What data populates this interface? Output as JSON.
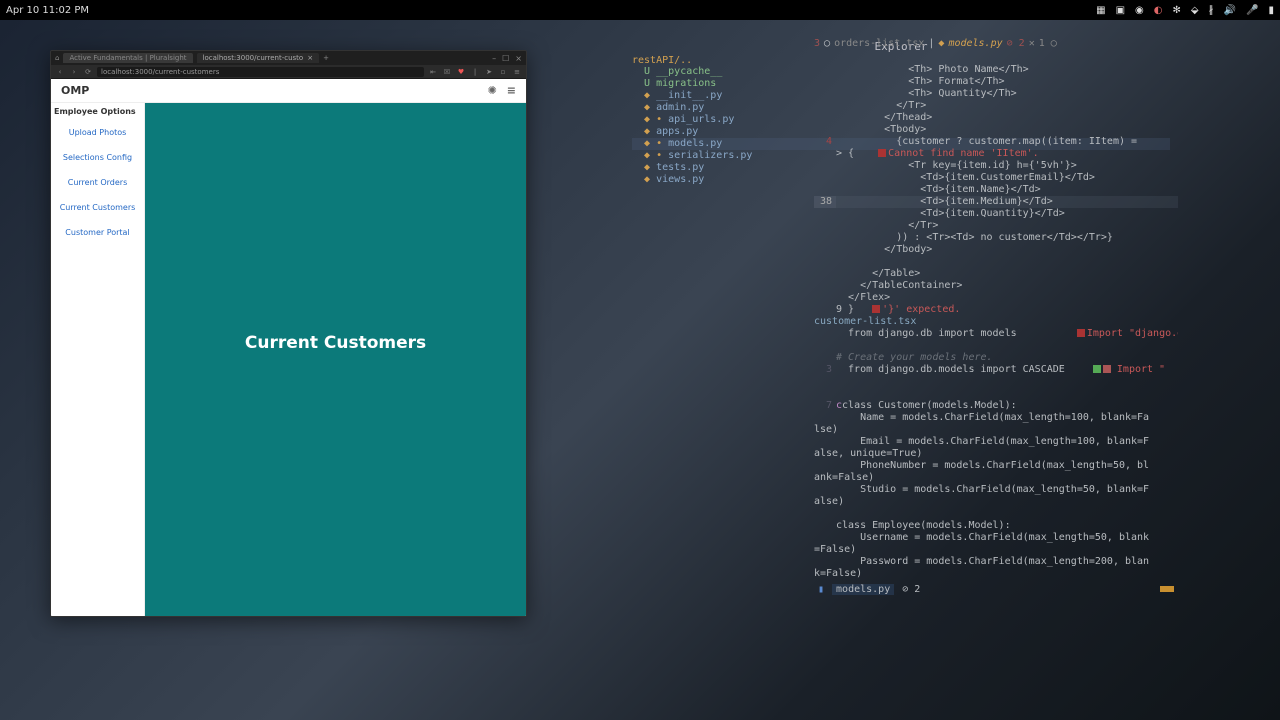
{
  "topbar": {
    "datetime": "Apr 10  11:02 PM"
  },
  "browser": {
    "tabs": [
      {
        "label": "Active Fundamentals | Pluralsight"
      },
      {
        "label": "localhost:3000/current-custo"
      }
    ],
    "url": "localhost:3000/current-customers",
    "app_title": "OMP",
    "sidebar_title": "Employee Options",
    "sidebar_items": [
      "Upload Photos",
      "Selections Config",
      "Current Orders",
      "Current Customers",
      "Customer Portal"
    ],
    "main_heading": "Current Customers"
  },
  "editor": {
    "explorer_title": "Explorer",
    "project_path": "restAPI/..",
    "tree": [
      {
        "marker": "U",
        "name": "__pycache__",
        "class": "u"
      },
      {
        "marker": "U",
        "name": "migrations",
        "class": "u"
      },
      {
        "marker": "◆",
        "name": "__init__.py",
        "class": "mod"
      },
      {
        "marker": "◆",
        "name": "admin.py",
        "class": "mod"
      },
      {
        "marker": "◆ •",
        "name": "api_urls.py",
        "class": "mod"
      },
      {
        "marker": "◆",
        "name": "apps.py",
        "class": "mod"
      },
      {
        "marker": "◆ •",
        "name": "models.py",
        "class": "mod",
        "active": true
      },
      {
        "marker": "◆ •",
        "name": "serializers.py",
        "class": "mod"
      },
      {
        "marker": "◆",
        "name": "tests.py",
        "class": "mod"
      },
      {
        "marker": "◆",
        "name": "views.py",
        "class": "mod"
      }
    ],
    "tabs": {
      "left_badge": "3",
      "tab1": "orders-list.tsx",
      "tab2": "models.py",
      "tab2_badge": "⊘ 2",
      "extra": "1 ◯"
    },
    "status": {
      "filename": "models.py",
      "count": "⊘ 2"
    },
    "code": {
      "l1": "            <Th> Photo Name</Th>",
      "l2": "            <Th> Format</Th>",
      "l3": "            <Th> Quantity</Th>",
      "l4": "          </Tr>",
      "l5": "        </Thead>",
      "l6": "        <Tbody>",
      "l7g": "4",
      "l7": "          {customer ? customer.map((item: IItem) =",
      "l8g": "> {",
      "l8e": "Cannot find name 'IItem'.",
      "l9": "            <Tr key={item.id} h={'5vh'}>",
      "l10": "              <Td>{item.CustomerEmail}</Td>",
      "l11": "              <Td>{item.Name}</Td>",
      "l12g": "38",
      "l12": "              <Td>{item.Medium}</Td>",
      "l13": "              <Td>{item.Quantity}</Td>",
      "l14": "            </Tr>",
      "l15": "          )) : <Tr><Td> no customer</Td></Tr>}",
      "l16": "        </Tbody>",
      "l17": "",
      "l18": "      </Table>",
      "l19": "    </TableContainer>",
      "l20": "  </Flex>",
      "l21g": "9 }",
      "l21e": "'}' expected.",
      "l22f": "customer-list.tsx",
      "l23": "  from django.db import models          ",
      "l23e": "Import \"django.db",
      "l24": "",
      "l25c": "# Create your models here.",
      "l26g": "3",
      "l26": "  from django.db.models import CASCADE    ",
      "l26e": "Import \"",
      "l27": "",
      "l28": "",
      "l29g": "7",
      "l29": "class Customer(models.Model):",
      "l30": "    Name = models.CharField(max_length=100, blank=Fa",
      "l30b": "lse)",
      "l31": "    Email = models.CharField(max_length=100, blank=F",
      "l31b": "alse, unique=True)",
      "l32": "    PhoneNumber = models.CharField(max_length=50, bl",
      "l32b": "ank=False)",
      "l33": "    Studio = models.CharField(max_length=50, blank=F",
      "l33b": "alse)",
      "l34": "",
      "l35": "class Employee(models.Model):",
      "l36": "    Username = models.CharField(max_length=50, blank",
      "l36b": "=False)",
      "l37": "    Password = models.CharField(max_length=200, blan",
      "l37b": "k=False)"
    }
  }
}
